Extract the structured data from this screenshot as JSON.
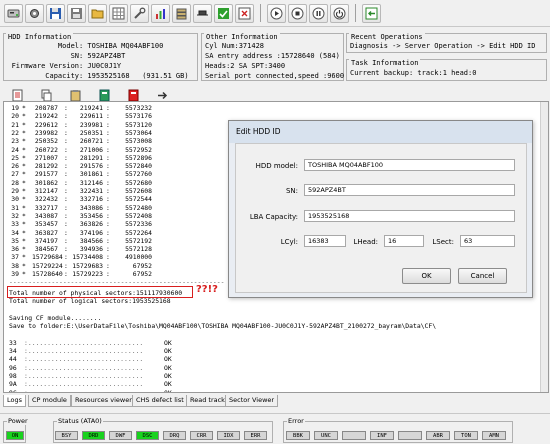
{
  "toolbar": {
    "groups": [
      [
        "drive-icon",
        "gear-icon",
        "floppy-icon",
        "save-icon",
        "folder-icon",
        "grid-icon",
        "tools-icon",
        "chart-icon",
        "stack-icon",
        "hat-icon",
        "check-icon",
        "close-square-icon"
      ],
      [
        "play-icon",
        "stop-icon",
        "pause-icon",
        "power-icon"
      ],
      [
        "exit-icon"
      ]
    ]
  },
  "hdd_info": {
    "title": "HDD Information",
    "rows": [
      [
        "Model",
        ": TOSHIBA MQ04ABF100"
      ],
      [
        "SN",
        ": 592APZ4BT"
      ],
      [
        "Firmware Version",
        ": JU0C0J1Y"
      ],
      [
        "Capacity",
        ": 1953525168   (931.51 GB)"
      ]
    ]
  },
  "other_info": {
    "title": "Other Information",
    "rows": [
      "Cyl Num:371428",
      "SA entry address :15728640 (584)",
      "Heads:2 SA SPT:3400",
      "Serial port connected,speed :9600"
    ]
  },
  "recent_ops": {
    "title": "Recent Operations",
    "text": "Diagnosis -> Server Operation -> Edit HDD ID"
  },
  "task_info": {
    "title": "Task Information",
    "text": "Current backup: track:1 head:0"
  },
  "toolbar2": {
    "icons": [
      "scroll-icon",
      "copy-icon",
      "paste-icon",
      "book-icon",
      "red-book-icon",
      "arrow-icon"
    ]
  },
  "log": {
    "table": [
      [
        "19",
        "*",
        "208787",
        ":",
        "219241",
        ":",
        "5573232"
      ],
      [
        "20",
        "*",
        "219242",
        ":",
        "229611",
        ":",
        "5573176"
      ],
      [
        "21",
        "*",
        "229612",
        ":",
        "239981",
        ":",
        "5573120"
      ],
      [
        "22",
        "*",
        "239982",
        ":",
        "250351",
        ":",
        "5573064"
      ],
      [
        "23",
        "*",
        "250352",
        ":",
        "260721",
        ":",
        "5573008"
      ],
      [
        "24",
        "*",
        "260722",
        ":",
        "271006",
        ":",
        "5572952"
      ],
      [
        "25",
        "*",
        "271007",
        ":",
        "281291",
        ":",
        "5572896"
      ],
      [
        "26",
        "*",
        "281292",
        ":",
        "291576",
        ":",
        "5572840"
      ],
      [
        "27",
        "*",
        "291577",
        ":",
        "301861",
        ":",
        "5572760"
      ],
      [
        "28",
        "*",
        "301862",
        ":",
        "312146",
        ":",
        "5572680"
      ],
      [
        "29",
        "*",
        "312147",
        ":",
        "322431",
        ":",
        "5572608"
      ],
      [
        "30",
        "*",
        "322432",
        ":",
        "332716",
        ":",
        "5572544"
      ],
      [
        "31",
        "*",
        "332717",
        ":",
        "343086",
        ":",
        "5572480"
      ],
      [
        "32",
        "*",
        "343087",
        ":",
        "353456",
        ":",
        "5572408"
      ],
      [
        "33",
        "*",
        "353457",
        ":",
        "363826",
        ":",
        "5572336"
      ],
      [
        "34",
        "*",
        "363827",
        ":",
        "374196",
        ":",
        "5572264"
      ],
      [
        "35",
        "*",
        "374197",
        ":",
        "384566",
        ":",
        "5572192"
      ],
      [
        "36",
        "*",
        "384567",
        ":",
        "394936",
        ":",
        "5572128"
      ],
      [
        "37",
        "*",
        "15729684",
        ":",
        "15734408",
        ":",
        "4910000"
      ],
      [
        "38",
        "*",
        "15729224",
        ":",
        "15729683",
        ":",
        "67952"
      ],
      [
        "39",
        "*",
        "15728640",
        ":",
        "15729223",
        ":",
        "67952"
      ]
    ],
    "divider": "--------------------------------------------------------",
    "phys": "Total number of physical sectors:151117930600",
    "annotation": "??!?",
    "logical": "Total number of logical sectors:1953525168",
    "saving": "Saving CF module........",
    "save_path": "Save to folder:E:\\UserDataFile\\Toshiba\\MQ04ABF100\\TOSHIBA MQ04ABF100-JU0C0J1Y-592APZ4BT_2100272_bayram\\Data\\CF\\",
    "ok_rows": [
      [
        "33",
        "OK"
      ],
      [
        "34",
        "OK"
      ],
      [
        "44",
        "OK"
      ],
      [
        "96",
        "OK"
      ],
      [
        "98",
        "OK"
      ],
      [
        "9A",
        "OK"
      ],
      [
        "9C",
        "OK"
      ]
    ]
  },
  "dialog": {
    "title": "Edit HDD ID",
    "model_label": "HDD model:",
    "model_value": "TOSHIBA MQ04ABF100",
    "sn_label": "SN:",
    "sn_value": "592APZ4BT",
    "lba_label": "LBA Capacity:",
    "lba_value": "1953525168",
    "lcyl_label": "LCyl:",
    "lcyl_value": "16383",
    "lhead_label": "LHead:",
    "lhead_value": "16",
    "lsect_label": "LSect:",
    "lsect_value": "63",
    "ok": "OK",
    "cancel": "Cancel"
  },
  "tabs": [
    "Logs",
    "CP module",
    "Resources viewer",
    "CHS defect list",
    "Read track",
    "Sector Viewer"
  ],
  "status": {
    "power_title": "Power",
    "power": "ON",
    "status_title": "Status (ATA0)",
    "status_leds": [
      "BSY",
      "DRD",
      "DWF",
      "DSC",
      "DRQ",
      "CRR",
      "IDX",
      "ERR"
    ],
    "status_on": [
      false,
      true,
      false,
      true,
      false,
      false,
      false,
      false
    ],
    "error_title": "Error",
    "error_leds": [
      "BBK",
      "UNC",
      "",
      "INF",
      "",
      "ABR",
      "TON",
      "AMN"
    ]
  },
  "colors": {
    "led_on": "#19d21e",
    "led_off": "#d6d6d6",
    "annotation": "#d81e1e"
  }
}
